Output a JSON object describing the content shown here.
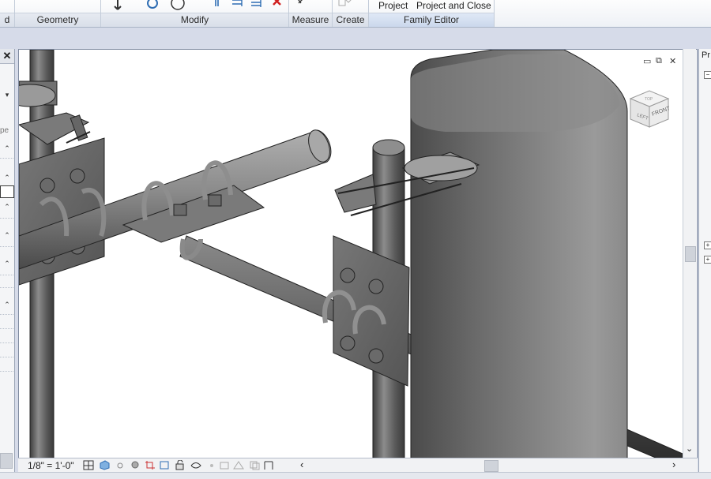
{
  "ribbon": {
    "panels": [
      {
        "title": "d"
      },
      {
        "title": "Geometry"
      },
      {
        "title": "Modify"
      },
      {
        "title": "Measure"
      },
      {
        "title": "Create"
      },
      {
        "title": "Family Editor"
      }
    ],
    "family_editor_buttons": {
      "load_into_project": "Project",
      "load_into_project_and_close": "Project and Close"
    }
  },
  "left_palette": {
    "close_glyph": "✕",
    "truncated_label": "pe"
  },
  "viewport": {
    "window_controls": {
      "minimize": "▭",
      "restore": "⧉",
      "close": "✕"
    },
    "viewcube": {
      "left_face": "LEFT",
      "front_face": "FRONT",
      "top_face": "TOP"
    }
  },
  "view_control_bar": {
    "scale": "1/8\" = 1'-0\"",
    "icons": [
      "detail-level-icon",
      "visual-style-icon",
      "sun-path-icon",
      "shadows-icon",
      "crop-view-icon",
      "show-crop-region-icon",
      "unlock-3d-view-icon",
      "temporary-hide-icon",
      "reveal-hidden-icon",
      "worksharing-display-icon",
      "analytical-model-icon",
      "highlight-displacement-icon",
      "reveal-constraints-icon"
    ],
    "scroll_left": "‹",
    "scroll_right": "›"
  },
  "vertical_scrollbar": {
    "down_arrow": "⌄"
  },
  "right_palette": {
    "title": "Pr"
  }
}
